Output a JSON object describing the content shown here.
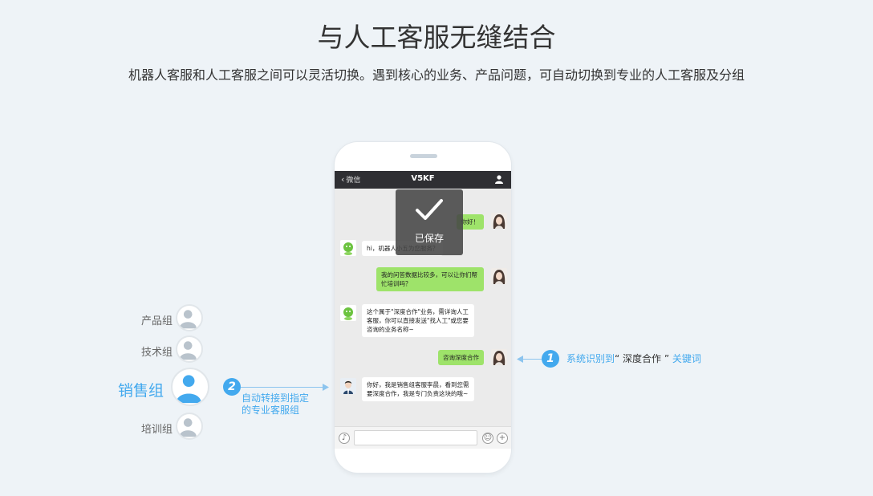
{
  "hero": {
    "title": "与人工客服无缝结合",
    "subtitle": "机器人客服和人工客服之间可以灵活切换。遇到核心的业务、产品问题，可自动切换到专业的人工客服及分组"
  },
  "phone": {
    "back_label": "微信",
    "title": "V5KF",
    "messages": [
      {
        "from": "user",
        "text": "你好！"
      },
      {
        "from": "bot",
        "text": "hi，机器人小五为您服务？"
      },
      {
        "from": "user",
        "text": "我的问答数据比较多，可以让你们帮忙培训吗？"
      },
      {
        "from": "bot",
        "text": "这个属于\"深度合作\"业务，需详询人工客服，你可以直接发送\"找人工\"或您要咨询的业务名称~"
      },
      {
        "from": "user",
        "text": "咨询深度合作"
      },
      {
        "from": "agent",
        "text": "你好，我是销售组客服李晨，看到您需要深度合作，我是专门负责这块的哦~"
      }
    ],
    "toast": "已保存"
  },
  "groups": {
    "product": "产品组",
    "tech": "技术组",
    "sales": "销售组",
    "training": "培训组"
  },
  "steps": {
    "one_number": "1",
    "one_prefix": "系统识别到",
    "one_keyword": "“ 深度合作 ”",
    "one_suffix": "关键词",
    "two_number": "2",
    "two_line1": "自动转接到指定",
    "two_line2": "的专业客服组"
  },
  "colors": {
    "accent": "#43a9ee",
    "user_bubble": "#9ee36a",
    "topbar": "#2f2f33"
  }
}
